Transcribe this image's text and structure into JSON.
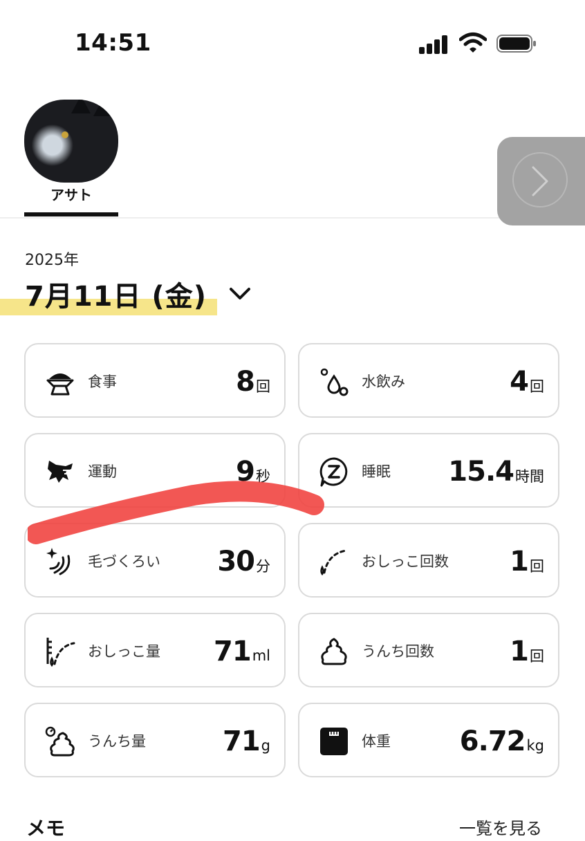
{
  "status_bar": {
    "time": "14:51",
    "icons": [
      "cellular-signal-icon",
      "wifi-icon",
      "battery-icon"
    ]
  },
  "pet_tabs": {
    "selected_pet": "アサト",
    "next_icon": "chevron-right-icon"
  },
  "date_header": {
    "year": "2025年",
    "date": "7月11日 (金)",
    "dropdown_icon": "chevron-down-icon",
    "highlight_color": "#f6e58a"
  },
  "stats": [
    {
      "icon": "food-bowl-icon",
      "label": "食事",
      "value": "8",
      "unit": "回"
    },
    {
      "icon": "water-drop-icon",
      "label": "水飲み",
      "value": "4",
      "unit": "回"
    },
    {
      "icon": "running-cat-icon",
      "label": "運動",
      "value": "9",
      "unit": "秒"
    },
    {
      "icon": "sleep-icon",
      "label": "睡眠",
      "value": "15.4",
      "unit": "時間"
    },
    {
      "icon": "grooming-icon",
      "label": "毛づくろい",
      "value": "30",
      "unit": "分"
    },
    {
      "icon": "pee-count-icon",
      "label": "おしっこ回数",
      "value": "1",
      "unit": "回"
    },
    {
      "icon": "pee-amount-icon",
      "label": "おしっこ量",
      "value": "71",
      "unit": "ml"
    },
    {
      "icon": "poop-count-icon",
      "label": "うんち回数",
      "value": "1",
      "unit": "回"
    },
    {
      "icon": "poop-amount-icon",
      "label": "うんち量",
      "value": "71",
      "unit": "g"
    },
    {
      "icon": "weight-scale-icon",
      "label": "体重",
      "value": "6.72",
      "unit": "kg"
    }
  ],
  "memo": {
    "title": "メモ",
    "view_all": "一覧を見る"
  },
  "colors": {
    "accent_yellow": "#f6e58a",
    "annotation_red": "#f0403c",
    "next_button_gray": "#a3a3a3"
  }
}
